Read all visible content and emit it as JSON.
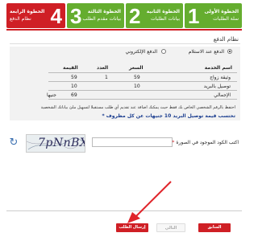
{
  "steps": [
    {
      "num": "1",
      "title": "الخطوة الأولى",
      "subtitle": "سلة الطلبات",
      "state": "done"
    },
    {
      "num": "2",
      "title": "الخطوة الثانية",
      "subtitle": "بيانات الطلبات",
      "state": "done"
    },
    {
      "num": "3",
      "title": "الخطوة الثالثة",
      "subtitle": "بيانات مقدم الطلب",
      "state": "done"
    },
    {
      "num": "4",
      "title": "الخطوة الرابعة",
      "subtitle": "نظام الدفع",
      "state": "active"
    }
  ],
  "payment": {
    "section_title": "نظام الدفع",
    "option_cash": "الدفع عند الاستلام",
    "option_electronic": "الدفع الإلكتروني",
    "table_headers": {
      "service": "اسم الخدمة",
      "price": "السعر",
      "count": "العدد",
      "value": "القيمة"
    },
    "rows": [
      {
        "service": "وثيقة زواج",
        "price": "59",
        "count": "1",
        "value": "59"
      },
      {
        "service": "توصيل بالبريد",
        "price": "10",
        "count": "",
        "value": "10"
      },
      {
        "service": "الإجمالي",
        "price": "",
        "count": "",
        "value": "69",
        "currency": "جنيها"
      }
    ],
    "privacy_note": "احتفظ بالرقم الشخصي الخاص بك فقط حيث يمكنك اضافة عند تقديم أي طلب مستقبلا لتسهيل ملئ بياناتك الشخصية",
    "delivery_note": "* تحتسب قيمة توصيل البريد 10 جنيهات عن كل مظروف"
  },
  "captcha": {
    "label": "اكتب الكود الموجود في الصورة",
    "required_mark": "*",
    "image_text": "7pNnBX",
    "input_value": ""
  },
  "buttons": {
    "prev": "السابق",
    "next": "التالي",
    "send": "إرسال الطلب"
  },
  "colors": {
    "step_done": "#65ad2f",
    "step_active": "#cf1f25",
    "annotation_arrow": "#e0242a"
  }
}
